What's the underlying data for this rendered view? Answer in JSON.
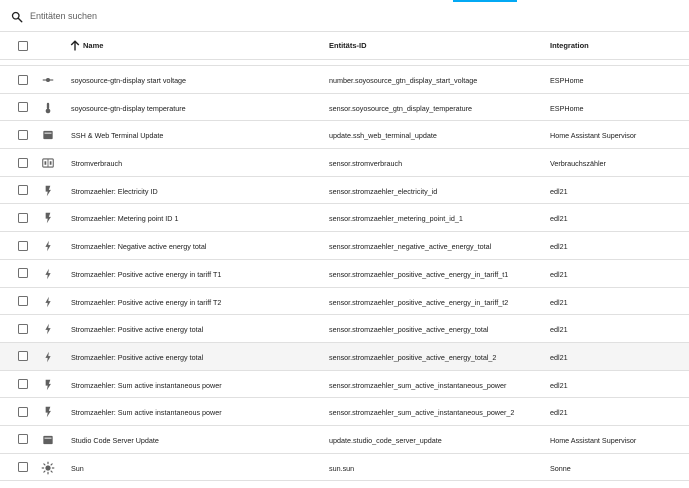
{
  "search": {
    "placeholder": "Entitäten suchen"
  },
  "table": {
    "columns": {
      "name": "Name",
      "entity_id": "Entitäts-ID",
      "integration": "Integration"
    },
    "sort": {
      "column": "name",
      "direction": "ascending"
    },
    "rows": [
      {
        "icon": "slider-icon",
        "name": "soyosource-gtn-display start voltage",
        "entity_id": "number.soyosource_gtn_display_start_voltage",
        "integration": "ESPHome"
      },
      {
        "icon": "thermometer-icon",
        "name": "soyosource-gtn-display temperature",
        "entity_id": "sensor.soyosource_gtn_display_temperature",
        "integration": "ESPHome"
      },
      {
        "icon": "package-up-icon",
        "name": "SSH & Web Terminal Update",
        "entity_id": "update.ssh_web_terminal_update",
        "integration": "Home Assistant Supervisor"
      },
      {
        "icon": "meter-icon",
        "name": "Stromverbrauch",
        "entity_id": "sensor.stromverbrauch",
        "integration": "Verbrauchszähler"
      },
      {
        "icon": "lightning-bolt-icon",
        "name": "Stromzaehler: Electricity ID",
        "entity_id": "sensor.stromzaehler_electricity_id",
        "integration": "edl21"
      },
      {
        "icon": "lightning-bolt-icon",
        "name": "Stromzaehler: Metering point ID 1",
        "entity_id": "sensor.stromzaehler_metering_point_id_1",
        "integration": "edl21"
      },
      {
        "icon": "flash-icon",
        "name": "Stromzaehler: Negative active energy total",
        "entity_id": "sensor.stromzaehler_negative_active_energy_total",
        "integration": "edl21"
      },
      {
        "icon": "flash-icon",
        "name": "Stromzaehler: Positive active energy in tariff T1",
        "entity_id": "sensor.stromzaehler_positive_active_energy_in_tariff_t1",
        "integration": "edl21"
      },
      {
        "icon": "flash-icon",
        "name": "Stromzaehler: Positive active energy in tariff T2",
        "entity_id": "sensor.stromzaehler_positive_active_energy_in_tariff_t2",
        "integration": "edl21"
      },
      {
        "icon": "flash-icon",
        "name": "Stromzaehler: Positive active energy total",
        "entity_id": "sensor.stromzaehler_positive_active_energy_total",
        "integration": "edl21"
      },
      {
        "icon": "flash-icon",
        "name": "Stromzaehler: Positive active energy total",
        "entity_id": "sensor.stromzaehler_positive_active_energy_total_2",
        "integration": "edl21",
        "highlight": true
      },
      {
        "icon": "lightning-bolt-icon",
        "name": "Stromzaehler: Sum active instantaneous power",
        "entity_id": "sensor.stromzaehler_sum_active_instantaneous_power",
        "integration": "edl21"
      },
      {
        "icon": "lightning-bolt-icon",
        "name": "Stromzaehler: Sum active instantaneous power",
        "entity_id": "sensor.stromzaehler_sum_active_instantaneous_power_2",
        "integration": "edl21"
      },
      {
        "icon": "package-up-icon",
        "name": "Studio Code Server Update",
        "entity_id": "update.studio_code_server_update",
        "integration": "Home Assistant Supervisor"
      },
      {
        "icon": "sun-icon",
        "name": "Sun",
        "entity_id": "sun.sun",
        "integration": "Sonne"
      }
    ]
  },
  "colors": {
    "accent": "#03a9f4",
    "icon": "#5f5f5f",
    "divider": "#e0e0e0",
    "highlight_row": "#f5f5f5"
  }
}
